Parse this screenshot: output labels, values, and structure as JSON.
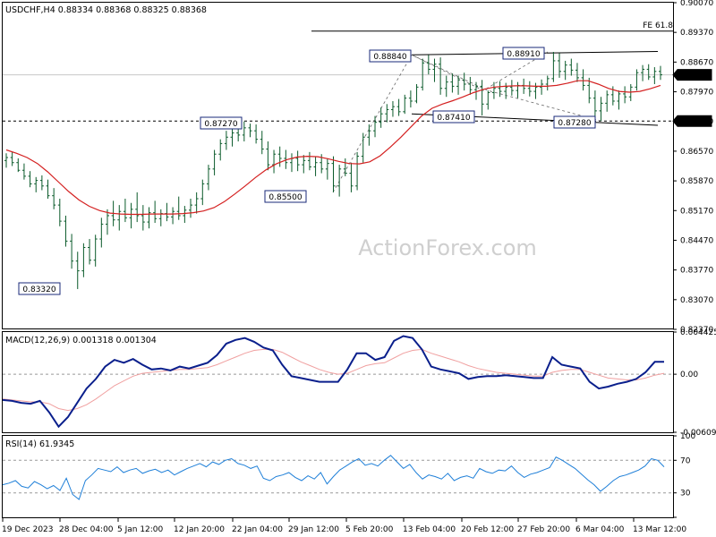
{
  "chart_data": {
    "type": "line",
    "symbol_header": "USDCHF,H4 0.88334 0.88368 0.88325 0.88368",
    "watermark": "ActionForex.com",
    "x_labels": [
      "19 Dec 2023",
      "28 Dec 04:00",
      "5 Jan 12:00",
      "12 Jan 20:00",
      "22 Jan 04:00",
      "29 Jan 12:00",
      "5 Feb 20:00",
      "13 Feb 04:00",
      "20 Feb 12:00",
      "27 Feb 20:00",
      "6 Mar 04:00",
      "13 Mar 12:00"
    ],
    "price": {
      "y_ticks": [
        "0.90070",
        "0.89370",
        "0.88670",
        "0.87970",
        "0.87270",
        "0.86570",
        "0.85870",
        "0.85170",
        "0.84470",
        "0.83770",
        "0.83070",
        "0.82370"
      ],
      "ylim": [
        0.8237,
        0.9007
      ],
      "bars": [
        {
          "o": 0.8635,
          "h": 0.8652,
          "l": 0.8618,
          "c": 0.8642
        },
        {
          "o": 0.8642,
          "h": 0.8655,
          "l": 0.8622,
          "c": 0.863
        },
        {
          "o": 0.863,
          "h": 0.864,
          "l": 0.8608,
          "c": 0.8612
        },
        {
          "o": 0.8612,
          "h": 0.8628,
          "l": 0.859,
          "c": 0.8598
        },
        {
          "o": 0.8598,
          "h": 0.861,
          "l": 0.8572,
          "c": 0.858
        },
        {
          "o": 0.858,
          "h": 0.8596,
          "l": 0.856,
          "c": 0.8588
        },
        {
          "o": 0.8588,
          "h": 0.86,
          "l": 0.8565,
          "c": 0.8575
        },
        {
          "o": 0.8575,
          "h": 0.859,
          "l": 0.8545,
          "c": 0.8552
        },
        {
          "o": 0.8552,
          "h": 0.857,
          "l": 0.852,
          "c": 0.853
        },
        {
          "o": 0.853,
          "h": 0.8545,
          "l": 0.848,
          "c": 0.8492
        },
        {
          "o": 0.8492,
          "h": 0.8505,
          "l": 0.8432,
          "c": 0.8445
        },
        {
          "o": 0.8445,
          "h": 0.8462,
          "l": 0.838,
          "c": 0.8398
        },
        {
          "o": 0.8398,
          "h": 0.842,
          "l": 0.8332,
          "c": 0.8375
        },
        {
          "o": 0.8375,
          "h": 0.844,
          "l": 0.836,
          "c": 0.843
        },
        {
          "o": 0.843,
          "h": 0.845,
          "l": 0.839,
          "c": 0.84
        },
        {
          "o": 0.84,
          "h": 0.846,
          "l": 0.8385,
          "c": 0.845
        },
        {
          "o": 0.845,
          "h": 0.85,
          "l": 0.843,
          "c": 0.8485
        },
        {
          "o": 0.8485,
          "h": 0.852,
          "l": 0.846,
          "c": 0.8505
        },
        {
          "o": 0.8505,
          "h": 0.854,
          "l": 0.848,
          "c": 0.8495
        },
        {
          "o": 0.8495,
          "h": 0.853,
          "l": 0.847,
          "c": 0.8515
        },
        {
          "o": 0.8515,
          "h": 0.8545,
          "l": 0.849,
          "c": 0.85
        },
        {
          "o": 0.85,
          "h": 0.8535,
          "l": 0.8475,
          "c": 0.852
        },
        {
          "o": 0.852,
          "h": 0.856,
          "l": 0.849,
          "c": 0.8505
        },
        {
          "o": 0.8505,
          "h": 0.853,
          "l": 0.847,
          "c": 0.849
        },
        {
          "o": 0.849,
          "h": 0.8525,
          "l": 0.8475,
          "c": 0.8512
        },
        {
          "o": 0.8512,
          "h": 0.854,
          "l": 0.8488,
          "c": 0.8498
        },
        {
          "o": 0.8498,
          "h": 0.852,
          "l": 0.848,
          "c": 0.851
        },
        {
          "o": 0.851,
          "h": 0.8535,
          "l": 0.8492,
          "c": 0.8502
        },
        {
          "o": 0.8502,
          "h": 0.8525,
          "l": 0.8485,
          "c": 0.8515
        },
        {
          "o": 0.8515,
          "h": 0.855,
          "l": 0.8495,
          "c": 0.8505
        },
        {
          "o": 0.8505,
          "h": 0.8528,
          "l": 0.8488,
          "c": 0.8518
        },
        {
          "o": 0.8518,
          "h": 0.8545,
          "l": 0.85,
          "c": 0.853
        },
        {
          "o": 0.853,
          "h": 0.856,
          "l": 0.851,
          "c": 0.8545
        },
        {
          "o": 0.8545,
          "h": 0.859,
          "l": 0.853,
          "c": 0.858
        },
        {
          "o": 0.858,
          "h": 0.8625,
          "l": 0.8565,
          "c": 0.8615
        },
        {
          "o": 0.8615,
          "h": 0.866,
          "l": 0.86,
          "c": 0.865
        },
        {
          "o": 0.865,
          "h": 0.8685,
          "l": 0.8635,
          "c": 0.8675
        },
        {
          "o": 0.8675,
          "h": 0.8705,
          "l": 0.866,
          "c": 0.869
        },
        {
          "o": 0.869,
          "h": 0.8712,
          "l": 0.8668,
          "c": 0.87
        },
        {
          "o": 0.87,
          "h": 0.8718,
          "l": 0.868,
          "c": 0.8695
        },
        {
          "o": 0.8695,
          "h": 0.8727,
          "l": 0.868,
          "c": 0.8712
        },
        {
          "o": 0.8712,
          "h": 0.8722,
          "l": 0.869,
          "c": 0.8705
        },
        {
          "o": 0.8705,
          "h": 0.872,
          "l": 0.8675,
          "c": 0.8685
        },
        {
          "o": 0.8685,
          "h": 0.8705,
          "l": 0.865,
          "c": 0.8662
        },
        {
          "o": 0.8662,
          "h": 0.868,
          "l": 0.8612,
          "c": 0.8625
        },
        {
          "o": 0.8625,
          "h": 0.866,
          "l": 0.8605,
          "c": 0.865
        },
        {
          "o": 0.865,
          "h": 0.8668,
          "l": 0.862,
          "c": 0.864
        },
        {
          "o": 0.864,
          "h": 0.866,
          "l": 0.8615,
          "c": 0.863
        },
        {
          "o": 0.863,
          "h": 0.8652,
          "l": 0.8608,
          "c": 0.864
        },
        {
          "o": 0.864,
          "h": 0.8658,
          "l": 0.861,
          "c": 0.8625
        },
        {
          "o": 0.8625,
          "h": 0.8648,
          "l": 0.8605,
          "c": 0.8635
        },
        {
          "o": 0.8635,
          "h": 0.8655,
          "l": 0.8612,
          "c": 0.862
        },
        {
          "o": 0.862,
          "h": 0.8645,
          "l": 0.8598,
          "c": 0.863
        },
        {
          "o": 0.863,
          "h": 0.865,
          "l": 0.8605,
          "c": 0.8615
        },
        {
          "o": 0.8615,
          "h": 0.864,
          "l": 0.859,
          "c": 0.8628
        },
        {
          "o": 0.8628,
          "h": 0.8645,
          "l": 0.856,
          "c": 0.8575
        },
        {
          "o": 0.8575,
          "h": 0.8625,
          "l": 0.855,
          "c": 0.8615
        },
        {
          "o": 0.8615,
          "h": 0.864,
          "l": 0.8598,
          "c": 0.8605
        },
        {
          "o": 0.8605,
          "h": 0.863,
          "l": 0.856,
          "c": 0.8575
        },
        {
          "o": 0.8575,
          "h": 0.8655,
          "l": 0.8565,
          "c": 0.8645
        },
        {
          "o": 0.8645,
          "h": 0.87,
          "l": 0.863,
          "c": 0.869
        },
        {
          "o": 0.869,
          "h": 0.872,
          "l": 0.867,
          "c": 0.8705
        },
        {
          "o": 0.8705,
          "h": 0.874,
          "l": 0.869,
          "c": 0.8725
        },
        {
          "o": 0.8725,
          "h": 0.876,
          "l": 0.8712,
          "c": 0.8745
        },
        {
          "o": 0.8745,
          "h": 0.8768,
          "l": 0.8725,
          "c": 0.8755
        },
        {
          "o": 0.8755,
          "h": 0.8775,
          "l": 0.8738,
          "c": 0.8762
        },
        {
          "o": 0.8762,
          "h": 0.878,
          "l": 0.874,
          "c": 0.875
        },
        {
          "o": 0.875,
          "h": 0.879,
          "l": 0.8745,
          "c": 0.8782
        },
        {
          "o": 0.8782,
          "h": 0.88,
          "l": 0.876,
          "c": 0.8775
        },
        {
          "o": 0.8775,
          "h": 0.8815,
          "l": 0.877,
          "c": 0.8808
        },
        {
          "o": 0.8808,
          "h": 0.8875,
          "l": 0.88,
          "c": 0.8865
        },
        {
          "o": 0.8865,
          "h": 0.8884,
          "l": 0.8838,
          "c": 0.885
        },
        {
          "o": 0.885,
          "h": 0.8875,
          "l": 0.882,
          "c": 0.8862
        },
        {
          "o": 0.8862,
          "h": 0.8878,
          "l": 0.879,
          "c": 0.8805
        },
        {
          "o": 0.8805,
          "h": 0.8835,
          "l": 0.8785,
          "c": 0.882
        },
        {
          "o": 0.882,
          "h": 0.884,
          "l": 0.8795,
          "c": 0.881
        },
        {
          "o": 0.881,
          "h": 0.8835,
          "l": 0.879,
          "c": 0.8825
        },
        {
          "o": 0.8825,
          "h": 0.8842,
          "l": 0.88,
          "c": 0.8815
        },
        {
          "o": 0.8815,
          "h": 0.8832,
          "l": 0.879,
          "c": 0.8802
        },
        {
          "o": 0.8802,
          "h": 0.882,
          "l": 0.8778,
          "c": 0.881
        },
        {
          "o": 0.881,
          "h": 0.8825,
          "l": 0.8741,
          "c": 0.8768
        },
        {
          "o": 0.8768,
          "h": 0.88,
          "l": 0.8755,
          "c": 0.8795
        },
        {
          "o": 0.8795,
          "h": 0.882,
          "l": 0.878,
          "c": 0.8805
        },
        {
          "o": 0.8805,
          "h": 0.8822,
          "l": 0.8785,
          "c": 0.8798
        },
        {
          "o": 0.8798,
          "h": 0.8818,
          "l": 0.878,
          "c": 0.8808
        },
        {
          "o": 0.8808,
          "h": 0.8825,
          "l": 0.8788,
          "c": 0.88
        },
        {
          "o": 0.88,
          "h": 0.882,
          "l": 0.8782,
          "c": 0.8812
        },
        {
          "o": 0.8812,
          "h": 0.8828,
          "l": 0.8792,
          "c": 0.8805
        },
        {
          "o": 0.8805,
          "h": 0.8822,
          "l": 0.8786,
          "c": 0.8798
        },
        {
          "o": 0.8798,
          "h": 0.8818,
          "l": 0.878,
          "c": 0.8808
        },
        {
          "o": 0.8808,
          "h": 0.8826,
          "l": 0.879,
          "c": 0.8815
        },
        {
          "o": 0.8815,
          "h": 0.8835,
          "l": 0.88,
          "c": 0.8828
        },
        {
          "o": 0.8828,
          "h": 0.8891,
          "l": 0.882,
          "c": 0.887
        },
        {
          "o": 0.887,
          "h": 0.8888,
          "l": 0.883,
          "c": 0.8845
        },
        {
          "o": 0.8845,
          "h": 0.887,
          "l": 0.8825,
          "c": 0.886
        },
        {
          "o": 0.886,
          "h": 0.8875,
          "l": 0.8835,
          "c": 0.8848
        },
        {
          "o": 0.8848,
          "h": 0.8865,
          "l": 0.882,
          "c": 0.883
        },
        {
          "o": 0.883,
          "h": 0.885,
          "l": 0.88,
          "c": 0.8812
        },
        {
          "o": 0.8812,
          "h": 0.883,
          "l": 0.877,
          "c": 0.8782
        },
        {
          "o": 0.8782,
          "h": 0.88,
          "l": 0.8738,
          "c": 0.8752
        },
        {
          "o": 0.8752,
          "h": 0.8785,
          "l": 0.8728,
          "c": 0.877
        },
        {
          "o": 0.877,
          "h": 0.88,
          "l": 0.875,
          "c": 0.879
        },
        {
          "o": 0.879,
          "h": 0.881,
          "l": 0.8765,
          "c": 0.8775
        },
        {
          "o": 0.8775,
          "h": 0.88,
          "l": 0.8755,
          "c": 0.8792
        },
        {
          "o": 0.8792,
          "h": 0.881,
          "l": 0.877,
          "c": 0.8785
        },
        {
          "o": 0.8785,
          "h": 0.8815,
          "l": 0.8775,
          "c": 0.8808
        },
        {
          "o": 0.8808,
          "h": 0.885,
          "l": 0.88,
          "c": 0.8842
        },
        {
          "o": 0.8842,
          "h": 0.886,
          "l": 0.8822,
          "c": 0.885
        },
        {
          "o": 0.885,
          "h": 0.8862,
          "l": 0.8825,
          "c": 0.8832
        },
        {
          "o": 0.8832,
          "h": 0.8855,
          "l": 0.8815,
          "c": 0.8845
        },
        {
          "o": 0.8845,
          "h": 0.8858,
          "l": 0.8825,
          "c": 0.8837
        }
      ],
      "ma_series": [
        0.866,
        0.8652,
        0.8642,
        0.8628,
        0.8608,
        0.8585,
        0.8562,
        0.8542,
        0.8527,
        0.8517,
        0.8511,
        0.8509,
        0.8508,
        0.8508,
        0.8509,
        0.8509,
        0.8509,
        0.851,
        0.8512,
        0.8516,
        0.8524,
        0.8538,
        0.8556,
        0.8575,
        0.8595,
        0.8613,
        0.8627,
        0.8637,
        0.8643,
        0.8645,
        0.8644,
        0.8639,
        0.8633,
        0.8628,
        0.8627,
        0.8632,
        0.8646,
        0.8667,
        0.869,
        0.8715,
        0.874,
        0.8758,
        0.8768,
        0.8776,
        0.8785,
        0.8795,
        0.8803,
        0.8808,
        0.881,
        0.8811,
        0.8811,
        0.881,
        0.881,
        0.8812,
        0.8817,
        0.8823,
        0.8823,
        0.8815,
        0.8805,
        0.8798,
        0.8796,
        0.8798,
        0.8804,
        0.8812
      ],
      "price_labels": [
        {
          "text": "0.88840",
          "x": 0.8884
        },
        {
          "text": "0.88910",
          "x": 0.8891
        },
        {
          "text": "0.87270",
          "x": 0.8727
        },
        {
          "text": "0.87410",
          "x": 0.8741
        },
        {
          "text": "0.87280",
          "x": 0.8728
        },
        {
          "text": "0.85500",
          "x": 0.855
        },
        {
          "text": "0.83320",
          "x": 0.8332
        }
      ],
      "current_price_tag": "0.88368",
      "hline_tag": "0.87280",
      "fe_label": "FE 61.8"
    },
    "macd": {
      "title": "MACD(12,26,9) 0.001318 0.001304",
      "y_ticks": [
        "0.004425",
        "0.00",
        "-0.006092"
      ],
      "ylim": [
        -0.006092,
        0.004425
      ],
      "macd_series": [
        -0.0027,
        -0.0028,
        -0.003,
        -0.0031,
        -0.0028,
        -0.004,
        -0.0055,
        -0.0045,
        -0.003,
        -0.0015,
        -0.0005,
        0.0008,
        0.0015,
        0.0012,
        0.0016,
        0.001,
        0.0005,
        0.0006,
        0.0004,
        0.0008,
        0.0006,
        0.0009,
        0.0012,
        0.002,
        0.0032,
        0.0036,
        0.0038,
        0.0034,
        0.0028,
        0.0025,
        0.001,
        -0.0002,
        -0.0004,
        -0.0006,
        -0.0008,
        -0.0008,
        -0.0008,
        0.0005,
        0.0022,
        0.0022,
        0.0015,
        0.0018,
        0.0035,
        0.004,
        0.0038,
        0.0026,
        0.0008,
        0.0005,
        0.0003,
        0.0001,
        -0.0005,
        -0.0003,
        -0.0002,
        -0.0002,
        -0.0001,
        -0.0002,
        -0.0003,
        -0.0004,
        -0.0004,
        0.0018,
        0.001,
        0.0008,
        0.0006,
        -0.0008,
        -0.0015,
        -0.0013,
        -0.001,
        -0.0008,
        -0.0005,
        0.0002,
        0.0013,
        0.0013
      ],
      "signal_series": [
        -0.0026,
        -0.0027,
        -0.0028,
        -0.0029,
        -0.0029,
        -0.0031,
        -0.0036,
        -0.0038,
        -0.0036,
        -0.0032,
        -0.0026,
        -0.0019,
        -0.0012,
        -0.0007,
        -0.0002,
        0.0001,
        0.0002,
        0.0003,
        0.0004,
        0.0005,
        0.0005,
        0.0006,
        0.0007,
        0.001,
        0.0014,
        0.0018,
        0.0022,
        0.0025,
        0.0026,
        0.0026,
        0.0023,
        0.0018,
        0.0013,
        0.0009,
        0.0005,
        0.0002,
        0.0,
        0.0001,
        0.0005,
        0.0009,
        0.0011,
        0.0012,
        0.0017,
        0.0022,
        0.0025,
        0.0026,
        0.0022,
        0.0019,
        0.0016,
        0.0013,
        0.0009,
        0.0006,
        0.0004,
        0.0002,
        0.0001,
        0.0,
        -0.0001,
        -0.0002,
        -0.0002,
        0.0002,
        0.0004,
        0.0005,
        0.0005,
        0.0002,
        -0.0001,
        -0.0004,
        -0.0005,
        -0.0006,
        -0.0006,
        -0.0004,
        -0.0001,
        0.0001
      ]
    },
    "rsi": {
      "title": "RSI(14) 61.9345",
      "y_ticks": [
        "100",
        "70",
        "30",
        "0"
      ],
      "ylim": [
        0,
        100
      ],
      "series": [
        40,
        42,
        45,
        38,
        36,
        44,
        40,
        35,
        39,
        33,
        48,
        28,
        22,
        45,
        52,
        60,
        58,
        56,
        62,
        55,
        58,
        60,
        54,
        57,
        59,
        55,
        58,
        52,
        56,
        60,
        63,
        66,
        62,
        68,
        65,
        70,
        72,
        66,
        64,
        60,
        63,
        48,
        45,
        50,
        52,
        55,
        49,
        45,
        51,
        47,
        55,
        41,
        50,
        58,
        63,
        68,
        72,
        64,
        66,
        63,
        70,
        76,
        68,
        60,
        65,
        55,
        47,
        52,
        50,
        47,
        54,
        45,
        49,
        51,
        48,
        60,
        56,
        54,
        58,
        57,
        63,
        55,
        49,
        53,
        55,
        58,
        61,
        74,
        70,
        65,
        60,
        53,
        46,
        40,
        32,
        38,
        45,
        50,
        52,
        55,
        58,
        63,
        72,
        70,
        62
      ]
    }
  }
}
